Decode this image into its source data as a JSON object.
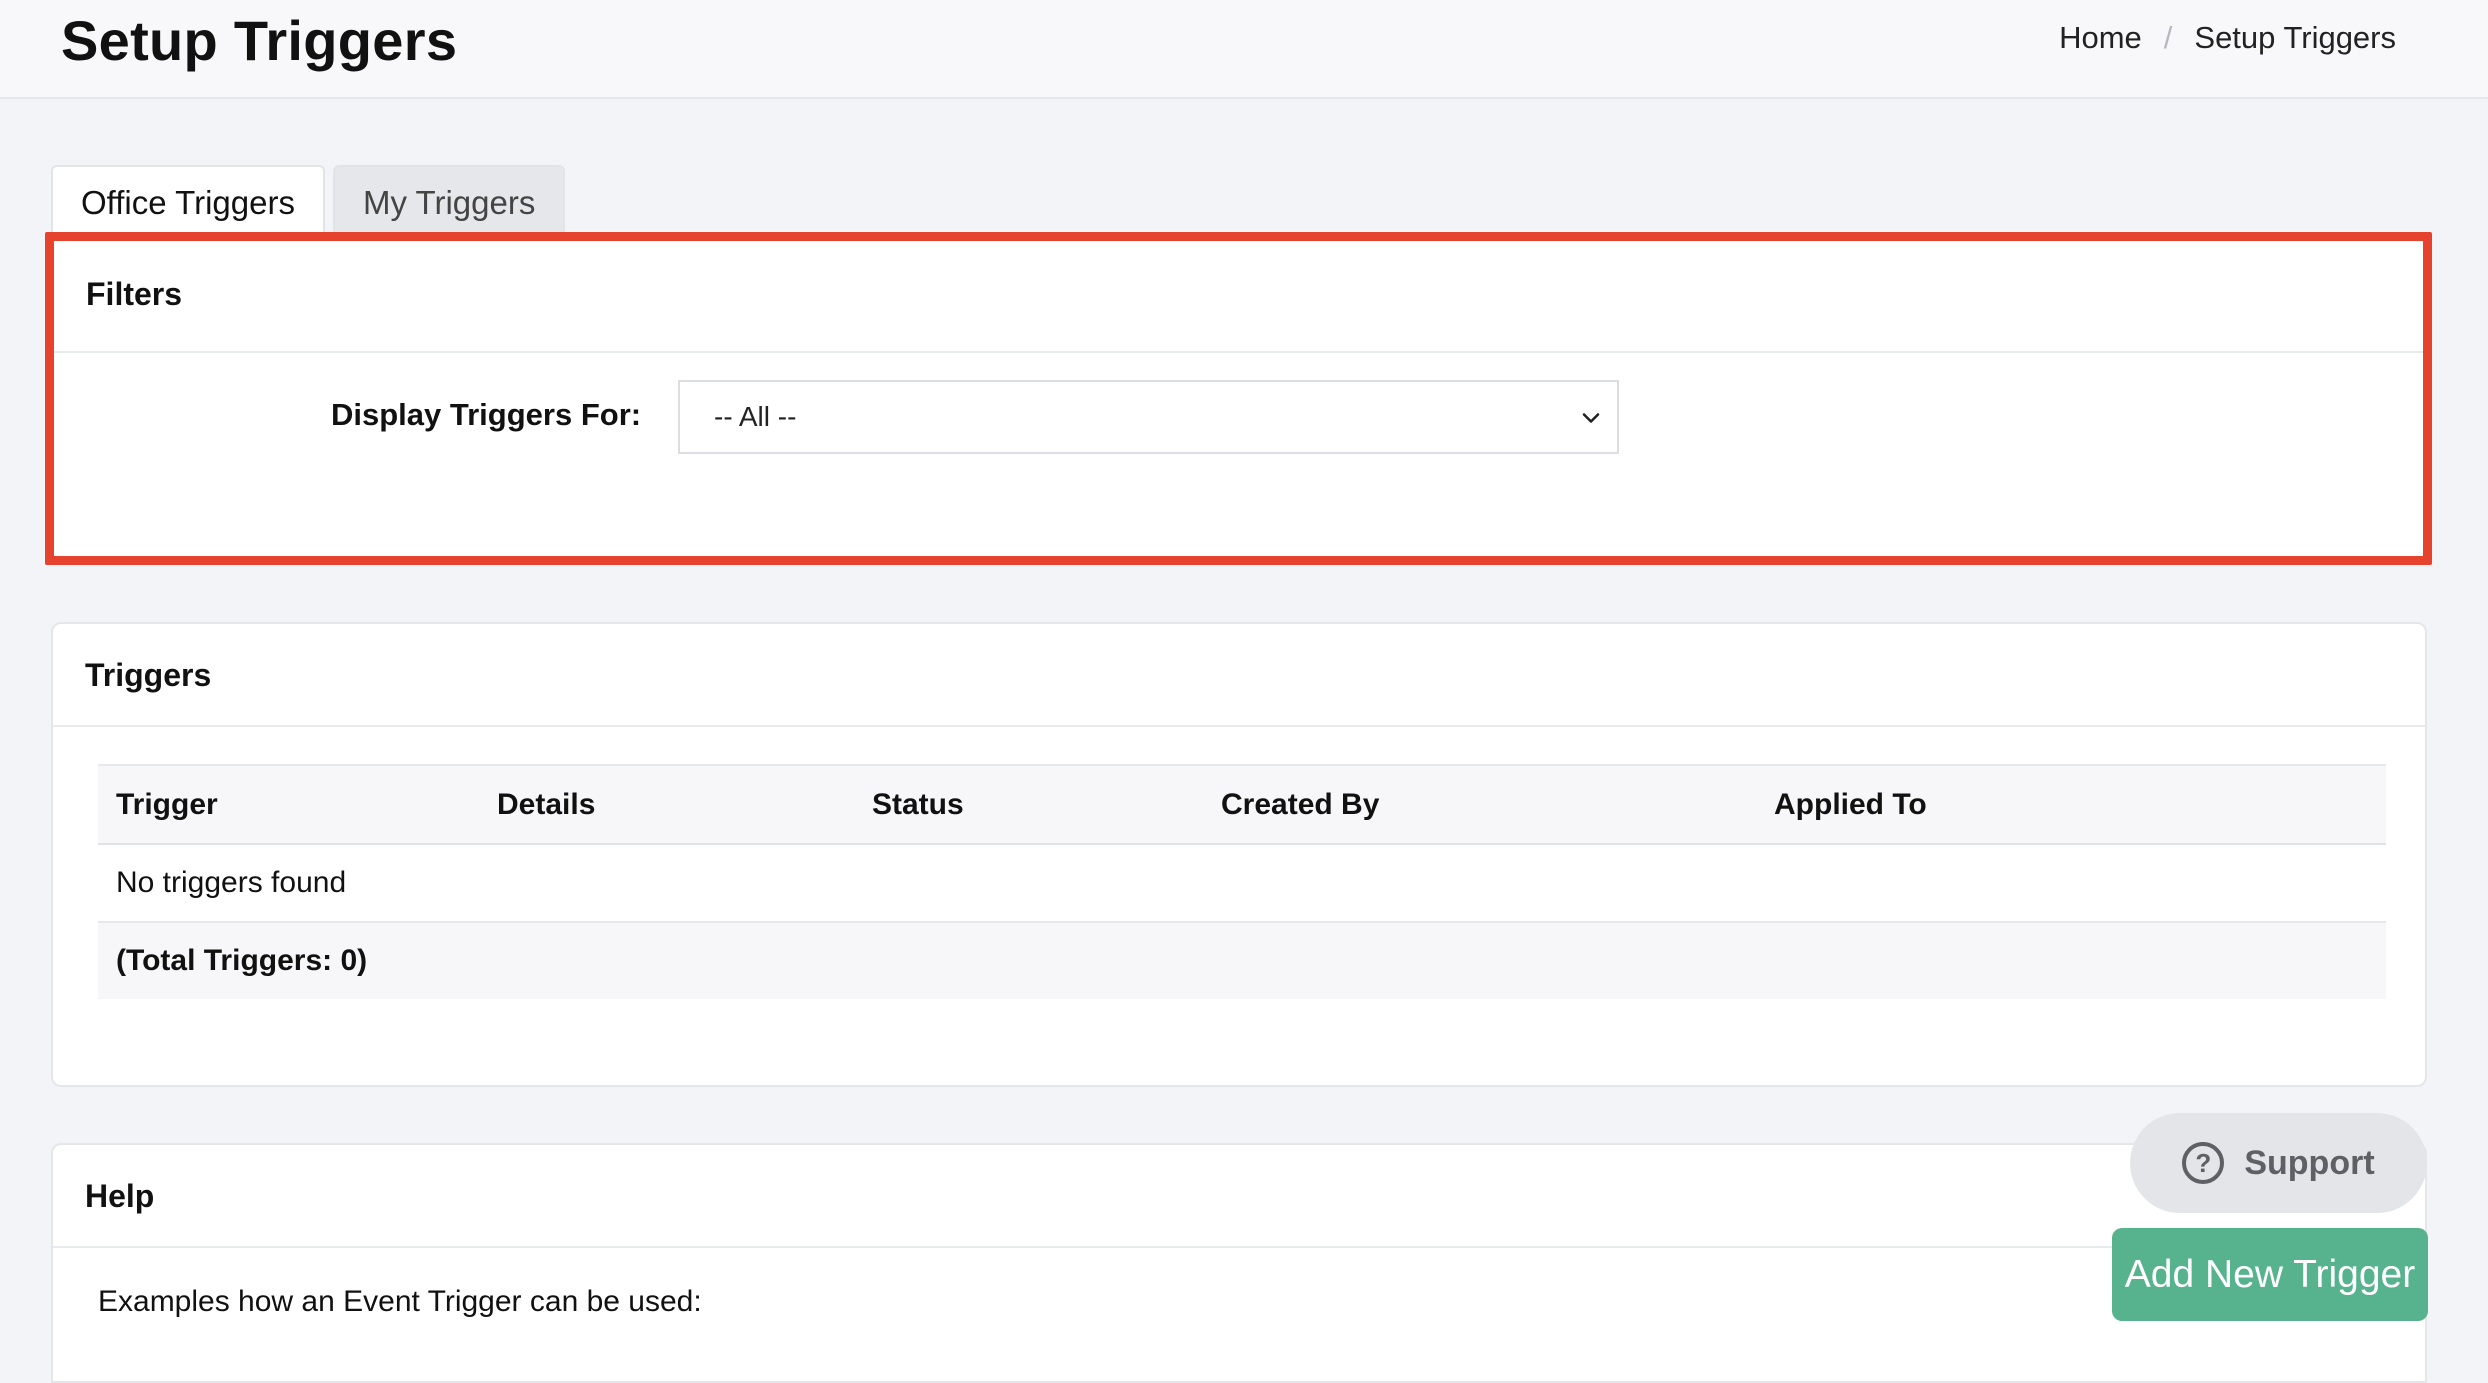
{
  "header": {
    "title": "Setup Triggers",
    "breadcrumb": {
      "home": "Home",
      "separator": "/",
      "current": "Setup Triggers"
    }
  },
  "tabs": [
    {
      "label": "Office Triggers",
      "active": true
    },
    {
      "label": "My Triggers",
      "active": false
    }
  ],
  "filters": {
    "title": "Filters",
    "display_label": "Display Triggers For:",
    "select_value": "-- All --",
    "highlight_color": "#e5432d"
  },
  "triggers": {
    "title": "Triggers",
    "columns": [
      "Trigger",
      "Details",
      "Status",
      "Created By",
      "Applied To"
    ],
    "empty_text": "No triggers found",
    "total_text": "(Total Triggers: 0)"
  },
  "help": {
    "title": "Help",
    "intro": "Examples how an Event Trigger can be used:"
  },
  "support": {
    "label": "Support",
    "icon": "question-circle-icon"
  },
  "add_button": {
    "label": "Add New Trigger",
    "color": "#56b38e"
  }
}
